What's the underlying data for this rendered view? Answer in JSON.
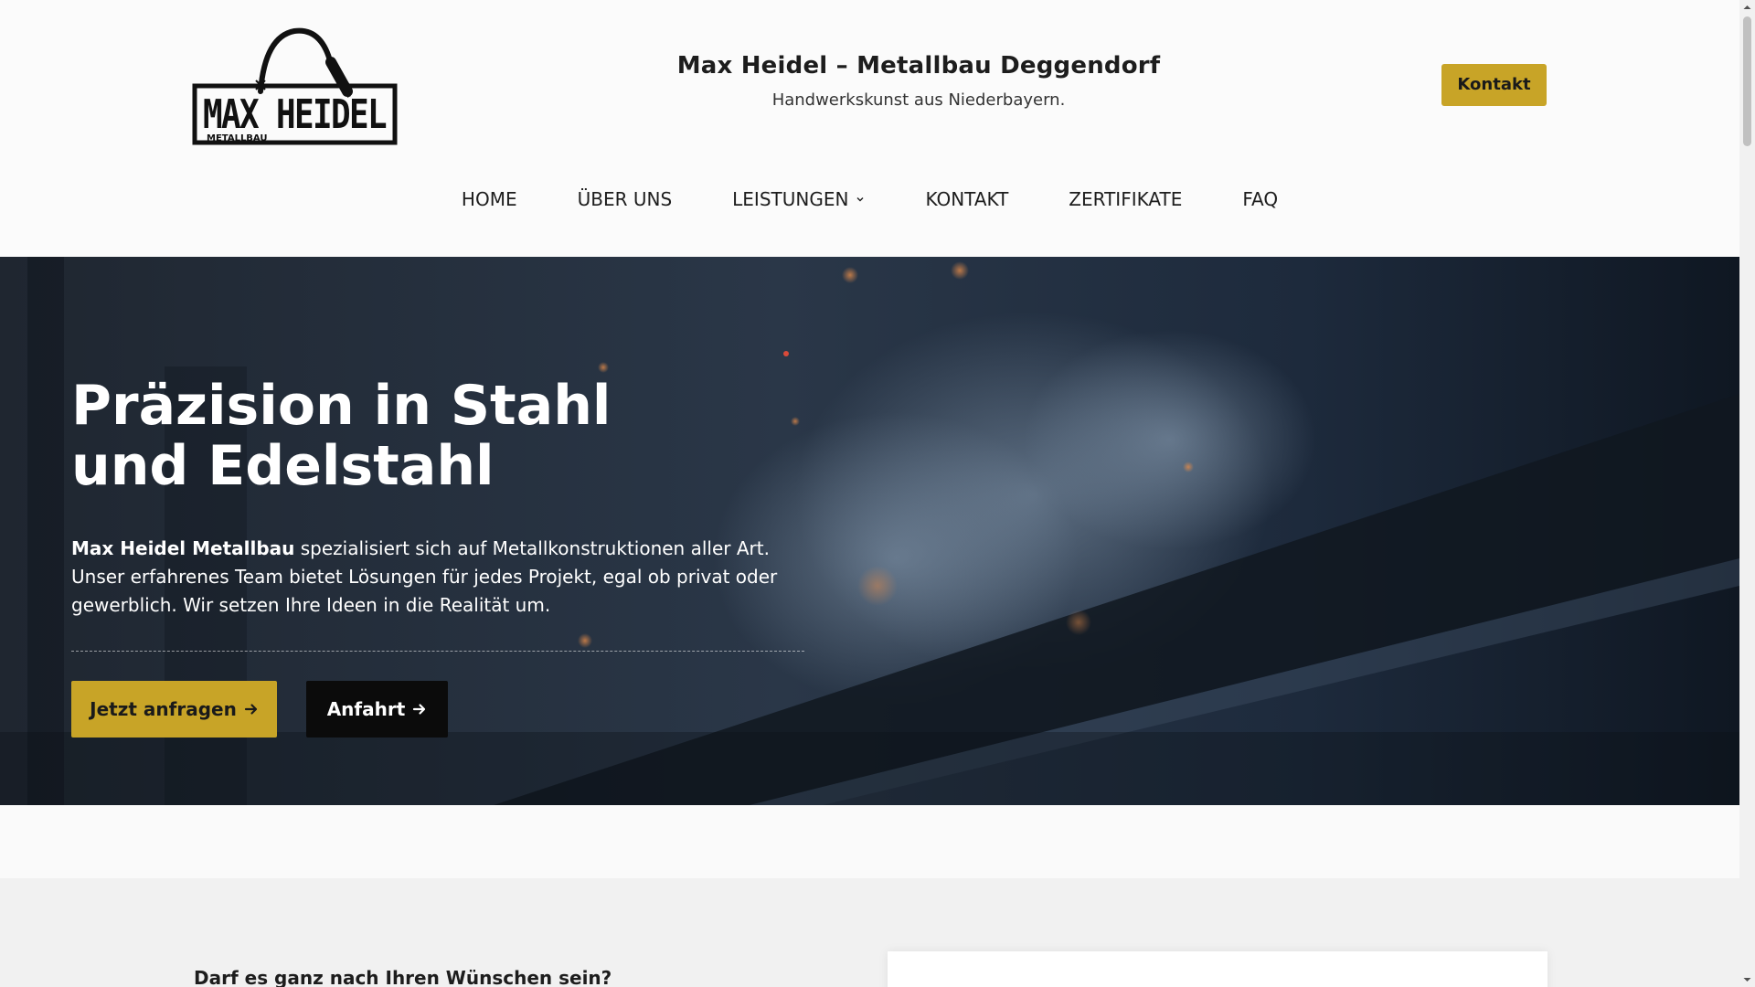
{
  "header": {
    "logo": {
      "wordmark": "MAX HEIDEL",
      "subline": "METALLBAU"
    },
    "site_title": "Max Heidel – Metallbau Deggendorf",
    "tagline": "Handwerkskunst aus Niederbayern.",
    "contact_button": "Kontakt"
  },
  "nav": {
    "items": [
      {
        "label": "HOME"
      },
      {
        "label": "ÜBER UNS"
      },
      {
        "label": "LEISTUNGEN",
        "dropdown": true
      },
      {
        "label": "KONTAKT"
      },
      {
        "label": "ZERTIFIKATE"
      },
      {
        "label": "FAQ"
      }
    ]
  },
  "hero": {
    "title": "Präzision in Stahl und Edelstahl",
    "intro_bold": "Max Heidel Metallbau",
    "intro_rest": " spezialisiert sich auf Metallkonstruktionen aller Art. Unser erfahrenes Team bietet Lösungen für jedes Projekt, egal ob privat oder gewerblich. Wir setzen Ihre Ideen in die Realität um.",
    "primary_button": "Jetzt anfragen",
    "secondary_button": "Anfahrt"
  },
  "section_two": {
    "question": "Darf es ganz nach Ihren Wünschen sein?"
  },
  "colors": {
    "accent": "#c8a427",
    "header_bg": "#fbfbfb",
    "hero_overlay": "#1b2431",
    "dark_button": "#0b0b0b",
    "section_bg": "#f1f1f1"
  },
  "icons": {
    "dropdown": "chevron-down-icon",
    "button_arrow": "arrow-right-icon",
    "logo_arc": "welding-torch-icon"
  }
}
